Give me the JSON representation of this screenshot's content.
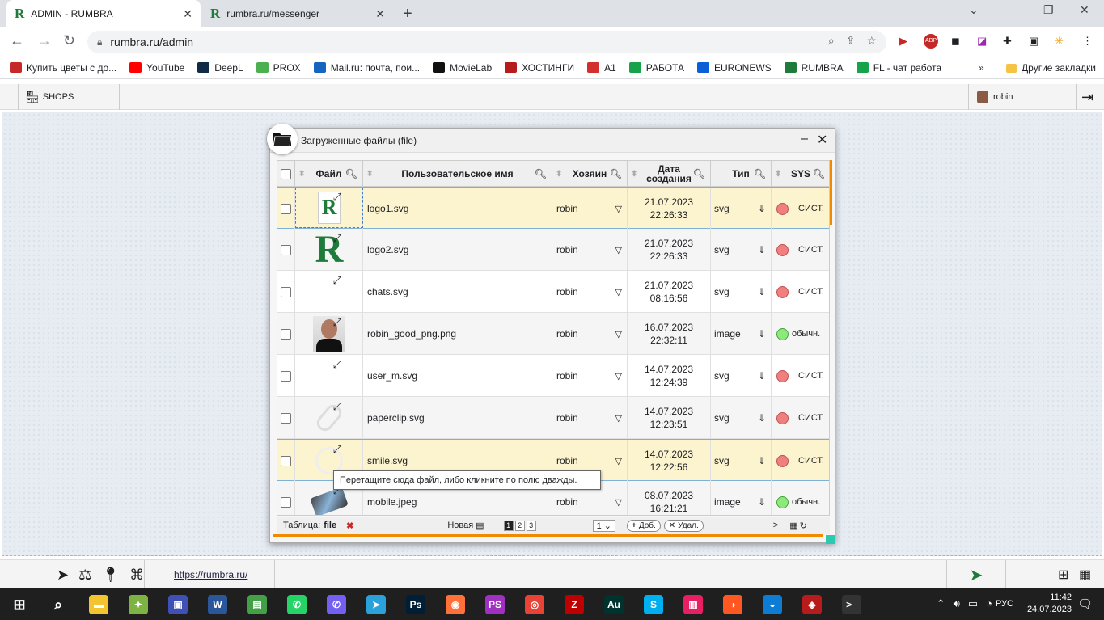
{
  "browser": {
    "tabs": [
      {
        "title": "ADMIN - RUMBRA",
        "active": true
      },
      {
        "title": "rumbra.ru/messenger",
        "active": false
      }
    ],
    "url": "rumbra.ru/admin",
    "bookmarks": [
      {
        "label": "Купить цветы с до...",
        "icon_color": "#c62828"
      },
      {
        "label": "YouTube",
        "icon_color": "#ff0000"
      },
      {
        "label": "DeepL",
        "icon_color": "#0f2b46"
      },
      {
        "label": "PROX",
        "icon_color": "#4caf50"
      },
      {
        "label": "Mail.ru: почта, пои...",
        "icon_color": "#1565c0"
      },
      {
        "label": "MovieLab",
        "icon_color": "#111111"
      },
      {
        "label": "ХОСТИНГИ",
        "icon_color": "#b71c1c"
      },
      {
        "label": "A1",
        "icon_color": "#d32f2f"
      },
      {
        "label": "РАБОТА",
        "icon_color": "#16a34a"
      },
      {
        "label": "EURONEWS",
        "icon_color": "#0b5ed7"
      },
      {
        "label": "RUMBRA",
        "icon_color": "#1e7b3a"
      },
      {
        "label": "FL - чат работа",
        "icon_color": "#16a34a"
      }
    ],
    "bookmarks_more": "»",
    "other_bookmarks": "Другие закладки",
    "extension_abp": "ABP"
  },
  "app": {
    "shops_label": "SHOPS",
    "user_name": "robin",
    "bottom_url": "https://rumbra.ru/"
  },
  "window": {
    "title": "Загруженные файлы (file)",
    "columns": {
      "file": "Файл",
      "custom_name": "Пользовательское имя",
      "owner": "Хозяин",
      "created_line1": "Дата",
      "created_line2": "создания",
      "type": "Тип",
      "sys": "SYS"
    },
    "rows": [
      {
        "name": "logo1.svg",
        "owner": "robin",
        "date": "21.07.2023",
        "time": "22:26:33",
        "type": "svg",
        "status": "red",
        "sys": "СИСТ.",
        "thumb": "r-small",
        "highlight": true
      },
      {
        "name": "logo2.svg",
        "owner": "robin",
        "date": "21.07.2023",
        "time": "22:26:33",
        "type": "svg",
        "status": "red",
        "sys": "СИСТ.",
        "thumb": "r-big"
      },
      {
        "name": "chats.svg",
        "owner": "robin",
        "date": "21.07.2023",
        "time": "08:16:56",
        "type": "svg",
        "status": "red",
        "sys": "СИСТ.",
        "thumb": "blank"
      },
      {
        "name": "robin_good_png.png",
        "owner": "robin",
        "date": "16.07.2023",
        "time": "22:32:11",
        "type": "image",
        "status": "green",
        "sys": "обычн.",
        "thumb": "photo"
      },
      {
        "name": "user_m.svg",
        "owner": "robin",
        "date": "14.07.2023",
        "time": "12:24:39",
        "type": "svg",
        "status": "red",
        "sys": "СИСТ.",
        "thumb": "blank"
      },
      {
        "name": "paperclip.svg",
        "owner": "robin",
        "date": "14.07.2023",
        "time": "12:23:51",
        "type": "svg",
        "status": "red",
        "sys": "СИСТ.",
        "thumb": "paperclip"
      },
      {
        "name": "smile.svg",
        "owner": "robin",
        "date": "14.07.2023",
        "time": "12:22:56",
        "type": "svg",
        "status": "red",
        "sys": "СИСТ.",
        "thumb": "smile",
        "highlight": true
      },
      {
        "name": "mobile.jpeg",
        "owner": "robin",
        "date": "08.07.2023",
        "time": "16:21:21",
        "type": "image",
        "status": "green",
        "sys": "обычн.",
        "thumb": "phone"
      }
    ],
    "footer": {
      "table_label": "Таблица:",
      "table_name": "file",
      "new_label": "Новая",
      "pages": [
        "1",
        "2",
        "3"
      ],
      "page_select": "1",
      "add_label": "Доб.",
      "delete_label": "Удал.",
      "next": ">"
    },
    "tooltip": "Перетащите сюда файл, либо кликните по полю дважды."
  },
  "taskbar": {
    "time": "11:42",
    "date": "24.07.2023",
    "lang": "РУС"
  }
}
